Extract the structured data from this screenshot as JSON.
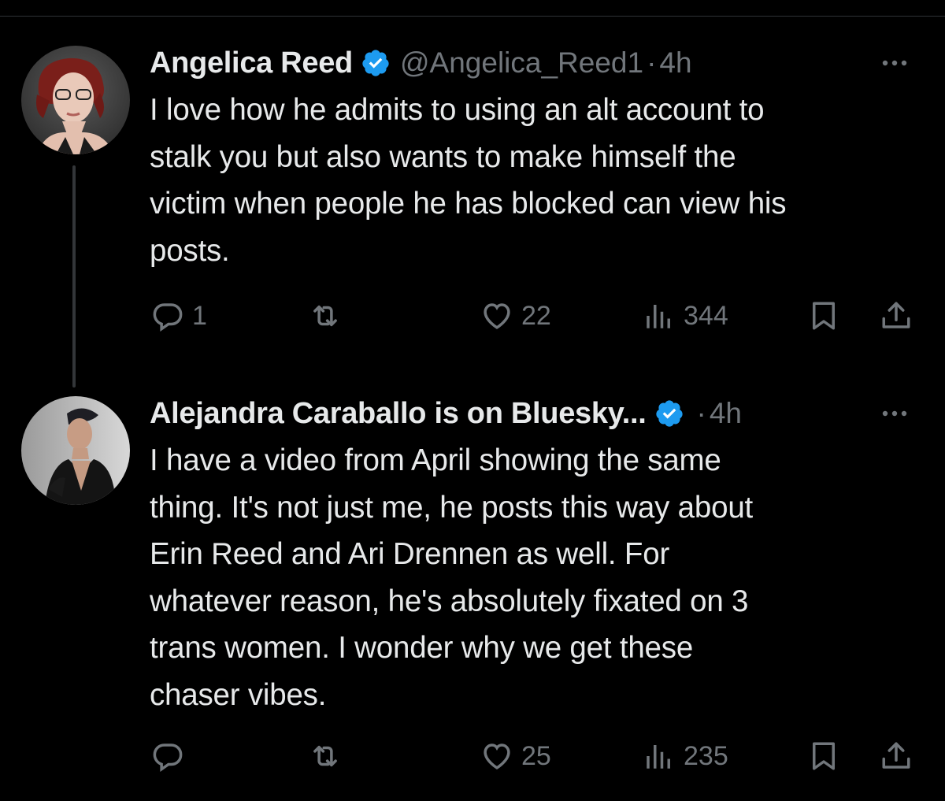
{
  "thread": [
    {
      "author": {
        "display_name": "Angelica Reed",
        "verified": true,
        "handle": "@Angelica_Reed1",
        "avatar": "avatar-photo-angelica"
      },
      "separator": "·",
      "timestamp": "4h",
      "text": "I love how he admits to using an alt account to\nstalk you but also wants to make himself the\nvictim when people he has blocked can view his\nposts.",
      "metrics": {
        "replies": "1",
        "retweets": "",
        "likes": "22",
        "views": "344"
      }
    },
    {
      "author": {
        "display_name": "Alejandra Caraballo is on Bluesky...",
        "verified": true,
        "handle": "",
        "avatar": "avatar-photo-alejandra"
      },
      "separator": "·",
      "timestamp": "4h",
      "text": "I have a video from April showing the same\nthing. It's not just me, he posts this way about\nErin Reed and Ari Drennen as well. For\nwhatever reason, he's absolutely fixated on 3\ntrans women. I wonder why we get these\nchaser vibes.",
      "metrics": {
        "replies": "",
        "retweets": "",
        "likes": "25",
        "views": "235"
      }
    }
  ],
  "icons": {
    "reply": "reply-icon",
    "retweet": "retweet-icon",
    "like": "heart-icon",
    "views": "views-icon",
    "bookmark": "bookmark-icon",
    "share": "share-icon",
    "more": "more-dots-icon",
    "verified": "verified-badge-icon"
  },
  "colors": {
    "background": "#000000",
    "primary_text": "#e7e9ea",
    "secondary_text": "#71767b",
    "verified_blue": "#1d9bf0",
    "thread_line": "#333639"
  }
}
